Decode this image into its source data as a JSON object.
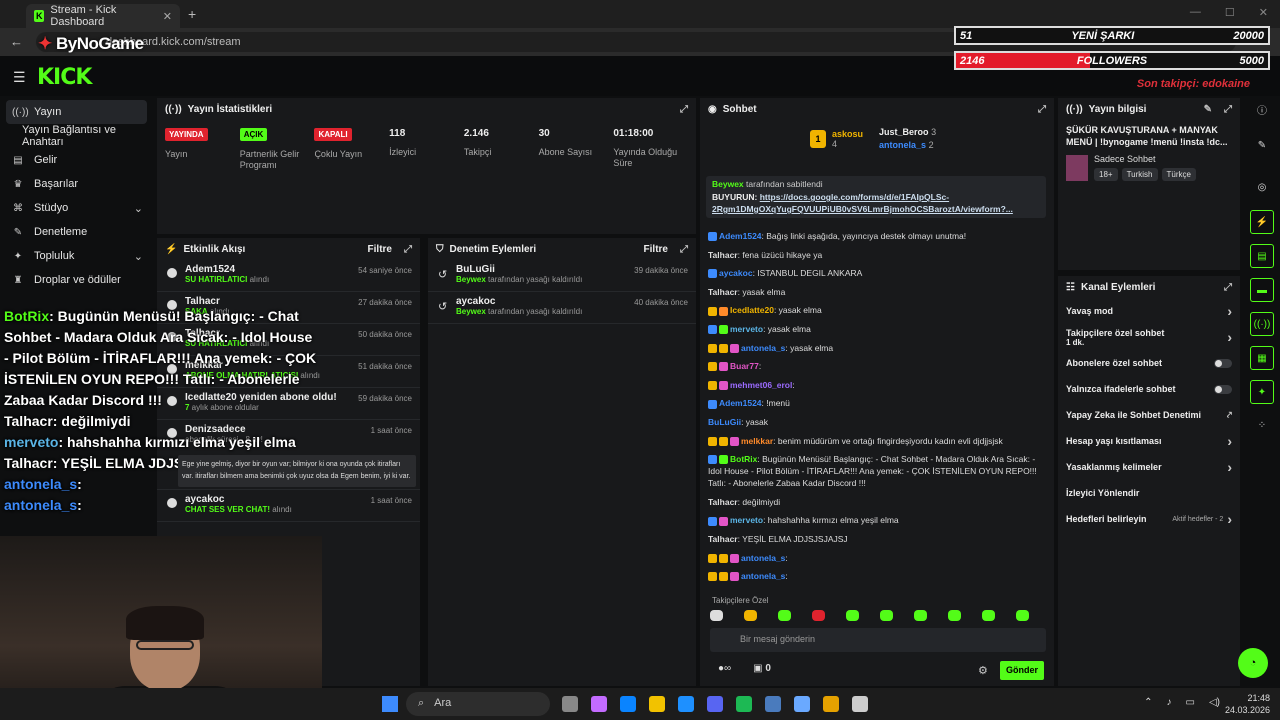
{
  "browser": {
    "tab_title": "Stream - Kick Dashboard",
    "url": "dashboard.kick.com/stream",
    "new_tab": "+",
    "close": "✕"
  },
  "overlay": {
    "logo_text": "ByNoGame",
    "songs_count": "51",
    "songs_label": "YENİ ŞARKI",
    "songs_goal": "20000",
    "followers_count": "2146",
    "followers_label": "FOLLOWERS",
    "followers_goal": "5000",
    "followers_progress": 0.43,
    "last_follower": "Son takipçi: edokaine"
  },
  "header": {
    "logo": "KICK"
  },
  "nav": {
    "items": [
      {
        "label": "Yayın",
        "icon": "broadcast-icon"
      },
      {
        "label": "Yayın Bağlantısı ve Anahtarı",
        "icon": ""
      },
      {
        "label": "Gelir",
        "icon": "dollar-icon"
      },
      {
        "label": "Başarılar",
        "icon": "trophy-icon"
      },
      {
        "label": "Stüdyo",
        "icon": "studio-icon",
        "chev": "⌄"
      },
      {
        "label": "Denetleme",
        "icon": "moderation-icon"
      },
      {
        "label": "Topluluk",
        "icon": "community-icon",
        "chev": "⌄"
      },
      {
        "label": "Droplar ve ödüller",
        "icon": "gift-icon"
      }
    ]
  },
  "stats": {
    "title": "Yayın İstatistikleri",
    "items": [
      {
        "badge": "YAYINDA",
        "badge_color": "red",
        "label": "Yayın"
      },
      {
        "badge": "AÇIK",
        "badge_color": "green",
        "label": "Partnerlik Gelir Programı"
      },
      {
        "badge": "KAPALI",
        "badge_color": "red",
        "label": "Çoklu Yayın"
      },
      {
        "value": "118",
        "label": "İzleyici"
      },
      {
        "value": "2.146",
        "label": "Takipçi"
      },
      {
        "value": "30",
        "label": "Abone Sayısı"
      },
      {
        "value": "01:18:00",
        "label": "Yayında Olduğu Süre"
      }
    ]
  },
  "activity": {
    "title": "Etkinlik Akışı",
    "filter": "Filtre",
    "items": [
      {
        "name": "Adem1524",
        "sub": "SU HATIRLATICI",
        "rest": " alındı",
        "time": "54 saniye önce"
      },
      {
        "name": "Talhacr",
        "sub": "ŞAKA",
        "rest": " alındı",
        "time": "27 dakika önce"
      },
      {
        "name": "Talhacr",
        "sub": "SU HATIRLATICI",
        "rest": " alındı",
        "time": "50 dakika önce"
      },
      {
        "name": "melkkar",
        "sub": "ABONE OLMA HATIRLATICISI",
        "rest": " alındı",
        "time": "51 dakika önce"
      },
      {
        "name": "Icedlatte20 yeniden abone oldu!",
        "sub": "7",
        "rest": " aylık abone oldular",
        "time": "59 dakika önce"
      },
      {
        "name": "Denizsadece",
        "sub": "",
        "rest": "abonelik süresi - 8 ay!",
        "time": "1 saat önce"
      },
      {
        "name": "aycakoc",
        "sub": "CHAT SES VER CHAT!",
        "rest": " alındı",
        "time": "1 saat önce"
      }
    ],
    "tooltip": "Ege yine gelmiş, diyor bir oyun var; bilmiyor ki ona oyunda çok itirafları var. itirafları bilmem ama benimki çok uyuz olsa da Egem benim, iyi ki var."
  },
  "moderation": {
    "title": "Denetim Eylemleri",
    "filter": "Filtre",
    "items": [
      {
        "name": "BuLuGii",
        "by": "Beywex",
        "rest": " tarafından yasağı kaldırıldı",
        "time": "39 dakika önce"
      },
      {
        "name": "aycakoc",
        "by": "Beywex",
        "rest": " tarafından yasağı kaldırıldı",
        "time": "40 dakika önce"
      }
    ]
  },
  "overlay_chat": [
    {
      "user": "BotRix",
      "cls": "u-g",
      "text": ": Bugünün Menüsü! Başlangıç: - Chat Sohbet - Madara Olduk  Ara Sıcak: - Idol House - Pilot Bölüm - İTİRAFLAR!!!  Ana yemek: - ÇOK İSTENİLEN OYUN REPO!!!  Tatlı: - Abonelerle Zabaa Kadar Discord !!!"
    },
    {
      "user": "Talhacr",
      "cls": "u-w",
      "text": ": değilmiydi"
    },
    {
      "user": "merveto",
      "cls": "u-c",
      "text": ": hahshahha kırmızı elma yeşil elma"
    },
    {
      "user": "Talhacr",
      "cls": "u-w",
      "text": ": YEŞİL ELMA JDJSJSJAJSJ"
    },
    {
      "user": "antonela_s",
      "cls": "u-b",
      "text": ":"
    },
    {
      "user": "antonela_s",
      "cls": "u-b",
      "text": ":"
    }
  ],
  "chat": {
    "title": "Sohbet",
    "leader1": {
      "name": "askosu",
      "count": "4"
    },
    "leader2": {
      "name": "Just_Beroo",
      "count": "3"
    },
    "leader3": {
      "name": "antonela_s",
      "count": "2"
    },
    "pinned_by": "Beywex",
    "pinned_rest": " tarafından sabitlendi",
    "pinned_prefix": "BUYURUN: ",
    "pinned_link": "https://docs.google.com/forms/d/e/1FAIpQLSc-2Rgm1DMgOXqYugFQVUUPiUB0vSV6LmrBjmohOCSBaroztA/viewform?...",
    "messages": [
      {
        "user": "Adem1524",
        "color": "#3d8bfd",
        "text": ": Bağış linki aşağıda, yayıncıya destek olmayı unutma!"
      },
      {
        "user": "Talhacr",
        "color": "#ddd",
        "text": ": fena üzücü hikaye ya"
      },
      {
        "user": "aycakoc",
        "color": "#3d8bfd",
        "text": ": ISTANBUL DEGIL ANKARA"
      },
      {
        "user": "Talhacr",
        "color": "#ddd",
        "text": ": yasak elma"
      },
      {
        "user": "Icedlatte20",
        "color": "#f0b400",
        "text": ": yasak elma"
      },
      {
        "user": "merveto",
        "color": "#5bb5e6",
        "text": ": yasak elma"
      },
      {
        "user": "antonela_s",
        "color": "#3d8bfd",
        "text": ": yasak elma"
      },
      {
        "user": "Buar77",
        "color": "#e255c6",
        "text": ":"
      },
      {
        "user": "mehmet06_erol",
        "color": "#9b6bff",
        "text": ":"
      },
      {
        "user": "Adem1524",
        "color": "#3d8bfd",
        "text": ": !menü"
      },
      {
        "user": "BuLuGii",
        "color": "#3d8bfd",
        "text": ": yasak"
      },
      {
        "user": "melkkar",
        "color": "#ff8a2a",
        "text": ": benim müdürüm ve ortağı fingirdeşiyordu kadın evli djdjjsjsk"
      },
      {
        "user": "BotRix",
        "color": "#53fc18",
        "text": ": Bugünün Menüsü! Başlangıç: - Chat Sohbet - Madara Olduk  Ara Sıcak: - Idol House - Pilot Bölüm - İTİRAFLAR!!!  Ana yemek: - ÇOK İSTENİLEN OYUN REPO!!!  Tatlı: - Abonelerle Zabaa Kadar Discord !!!"
      },
      {
        "user": "Talhacr",
        "color": "#ddd",
        "text": ": değilmiydi"
      },
      {
        "user": "merveto",
        "color": "#5bb5e6",
        "text": ": hahshahha kırmızı elma yeşil elma"
      },
      {
        "user": "Talhacr",
        "color": "#ddd",
        "text": ": YEŞİL ELMA JDJSJSJAJSJ"
      },
      {
        "user": "antonela_s",
        "color": "#3d8bfd",
        "text": ":"
      },
      {
        "user": "antonela_s",
        "color": "#3d8bfd",
        "text": ":"
      }
    ],
    "followers_only": "Takipçilere Özel",
    "input_placeholder": "Bir mesaj gönderin",
    "points": "0",
    "send": "Gönder"
  },
  "info": {
    "title": "Yayın bilgisi",
    "stream_title": "ŞÜKÜR KAVUŞTURANA + MANYAK MENÜ | !bynogame !menü !insta !dc...",
    "category": "Sadece Sohbet",
    "tags": [
      "18+",
      "Turkish",
      "Türkçe"
    ]
  },
  "actions": {
    "title": "Kanal Eylemleri",
    "items": [
      {
        "label": "Yavaş mod",
        "type": "chev"
      },
      {
        "label": "Takipçilere özel sohbet",
        "sub": "1 dk.",
        "type": "chev"
      },
      {
        "label": "Abonelere özel sohbet",
        "type": "toggle"
      },
      {
        "label": "Yalnızca ifadelerle sohbet",
        "type": "toggle"
      },
      {
        "label": "Yapay Zeka ile Sohbet Denetimi",
        "type": "ext"
      },
      {
        "label": "Hesap yaşı kısıtlaması",
        "type": "chev"
      },
      {
        "label": "Yasaklanmış kelimeler",
        "type": "chev"
      },
      {
        "label": "İzleyici Yönlendir",
        "type": "none"
      },
      {
        "label": "Hedefleri belirleyin",
        "extra": "Aktif hedefler - 2",
        "type": "chev"
      }
    ]
  },
  "taskbar": {
    "search": "Ara",
    "time": "21:48",
    "date": "24.03.2026"
  },
  "colors": {
    "accent": "#53fc18",
    "live_red": "#e0232e",
    "panel_bg": "#18191b"
  }
}
